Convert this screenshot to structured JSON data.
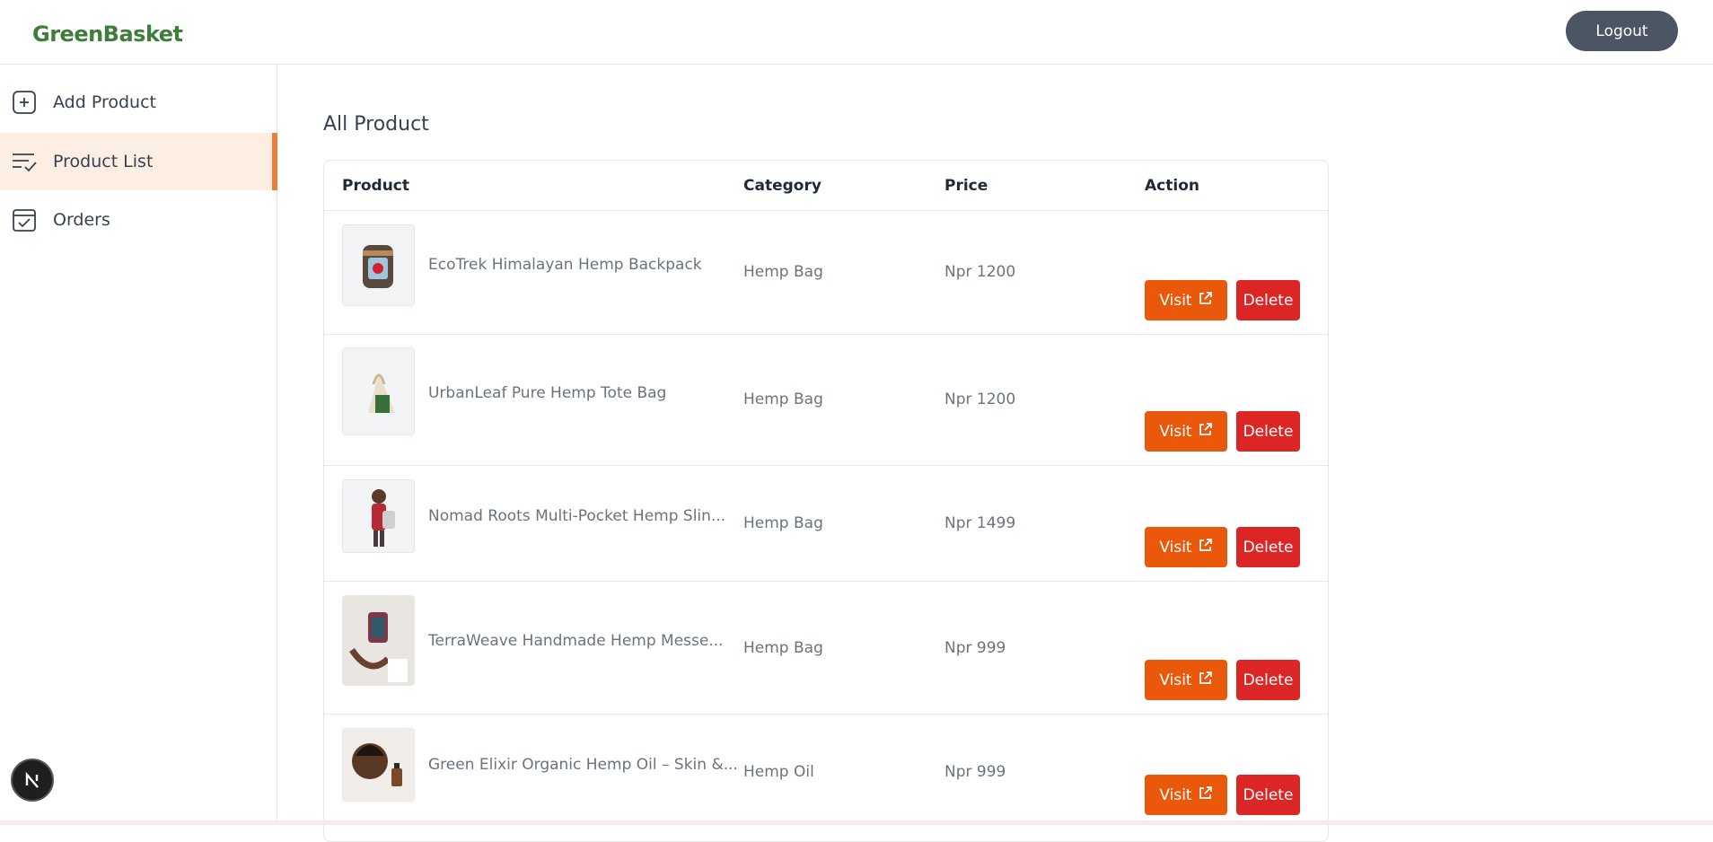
{
  "header": {
    "brand": "GreenBasket",
    "logout_label": "Logout"
  },
  "sidebar": {
    "items": [
      {
        "label": "Add Product",
        "icon": "add-square-icon",
        "active": false
      },
      {
        "label": "Product List",
        "icon": "list-check-icon",
        "active": true
      },
      {
        "label": "Orders",
        "icon": "calendar-check-icon",
        "active": false
      }
    ]
  },
  "main": {
    "title": "All Product",
    "columns": [
      "Product",
      "Category",
      "Price",
      "Action"
    ],
    "visit_label": "Visit",
    "delete_label": "Delete",
    "rows": [
      {
        "name": "EcoTrek Himalayan Hemp Backpack",
        "category": "Hemp Bag",
        "price": "Npr 1200"
      },
      {
        "name": "UrbanLeaf Pure Hemp Tote Bag",
        "category": "Hemp Bag",
        "price": "Npr 1200"
      },
      {
        "name": "Nomad Roots Multi-Pocket Hemp Slin...",
        "category": "Hemp Bag",
        "price": "Npr 1499"
      },
      {
        "name": "TerraWeave Handmade Hemp Messe...",
        "category": "Hemp Bag",
        "price": "Npr 999"
      },
      {
        "name": "Green Elixir Organic Hemp Oil – Skin &...",
        "category": "Hemp Oil",
        "price": "Npr 999"
      }
    ]
  },
  "colors": {
    "brand": "#3f7d3a",
    "accent": "#ea580c",
    "danger": "#dc2626",
    "logout": "#4b5563"
  }
}
